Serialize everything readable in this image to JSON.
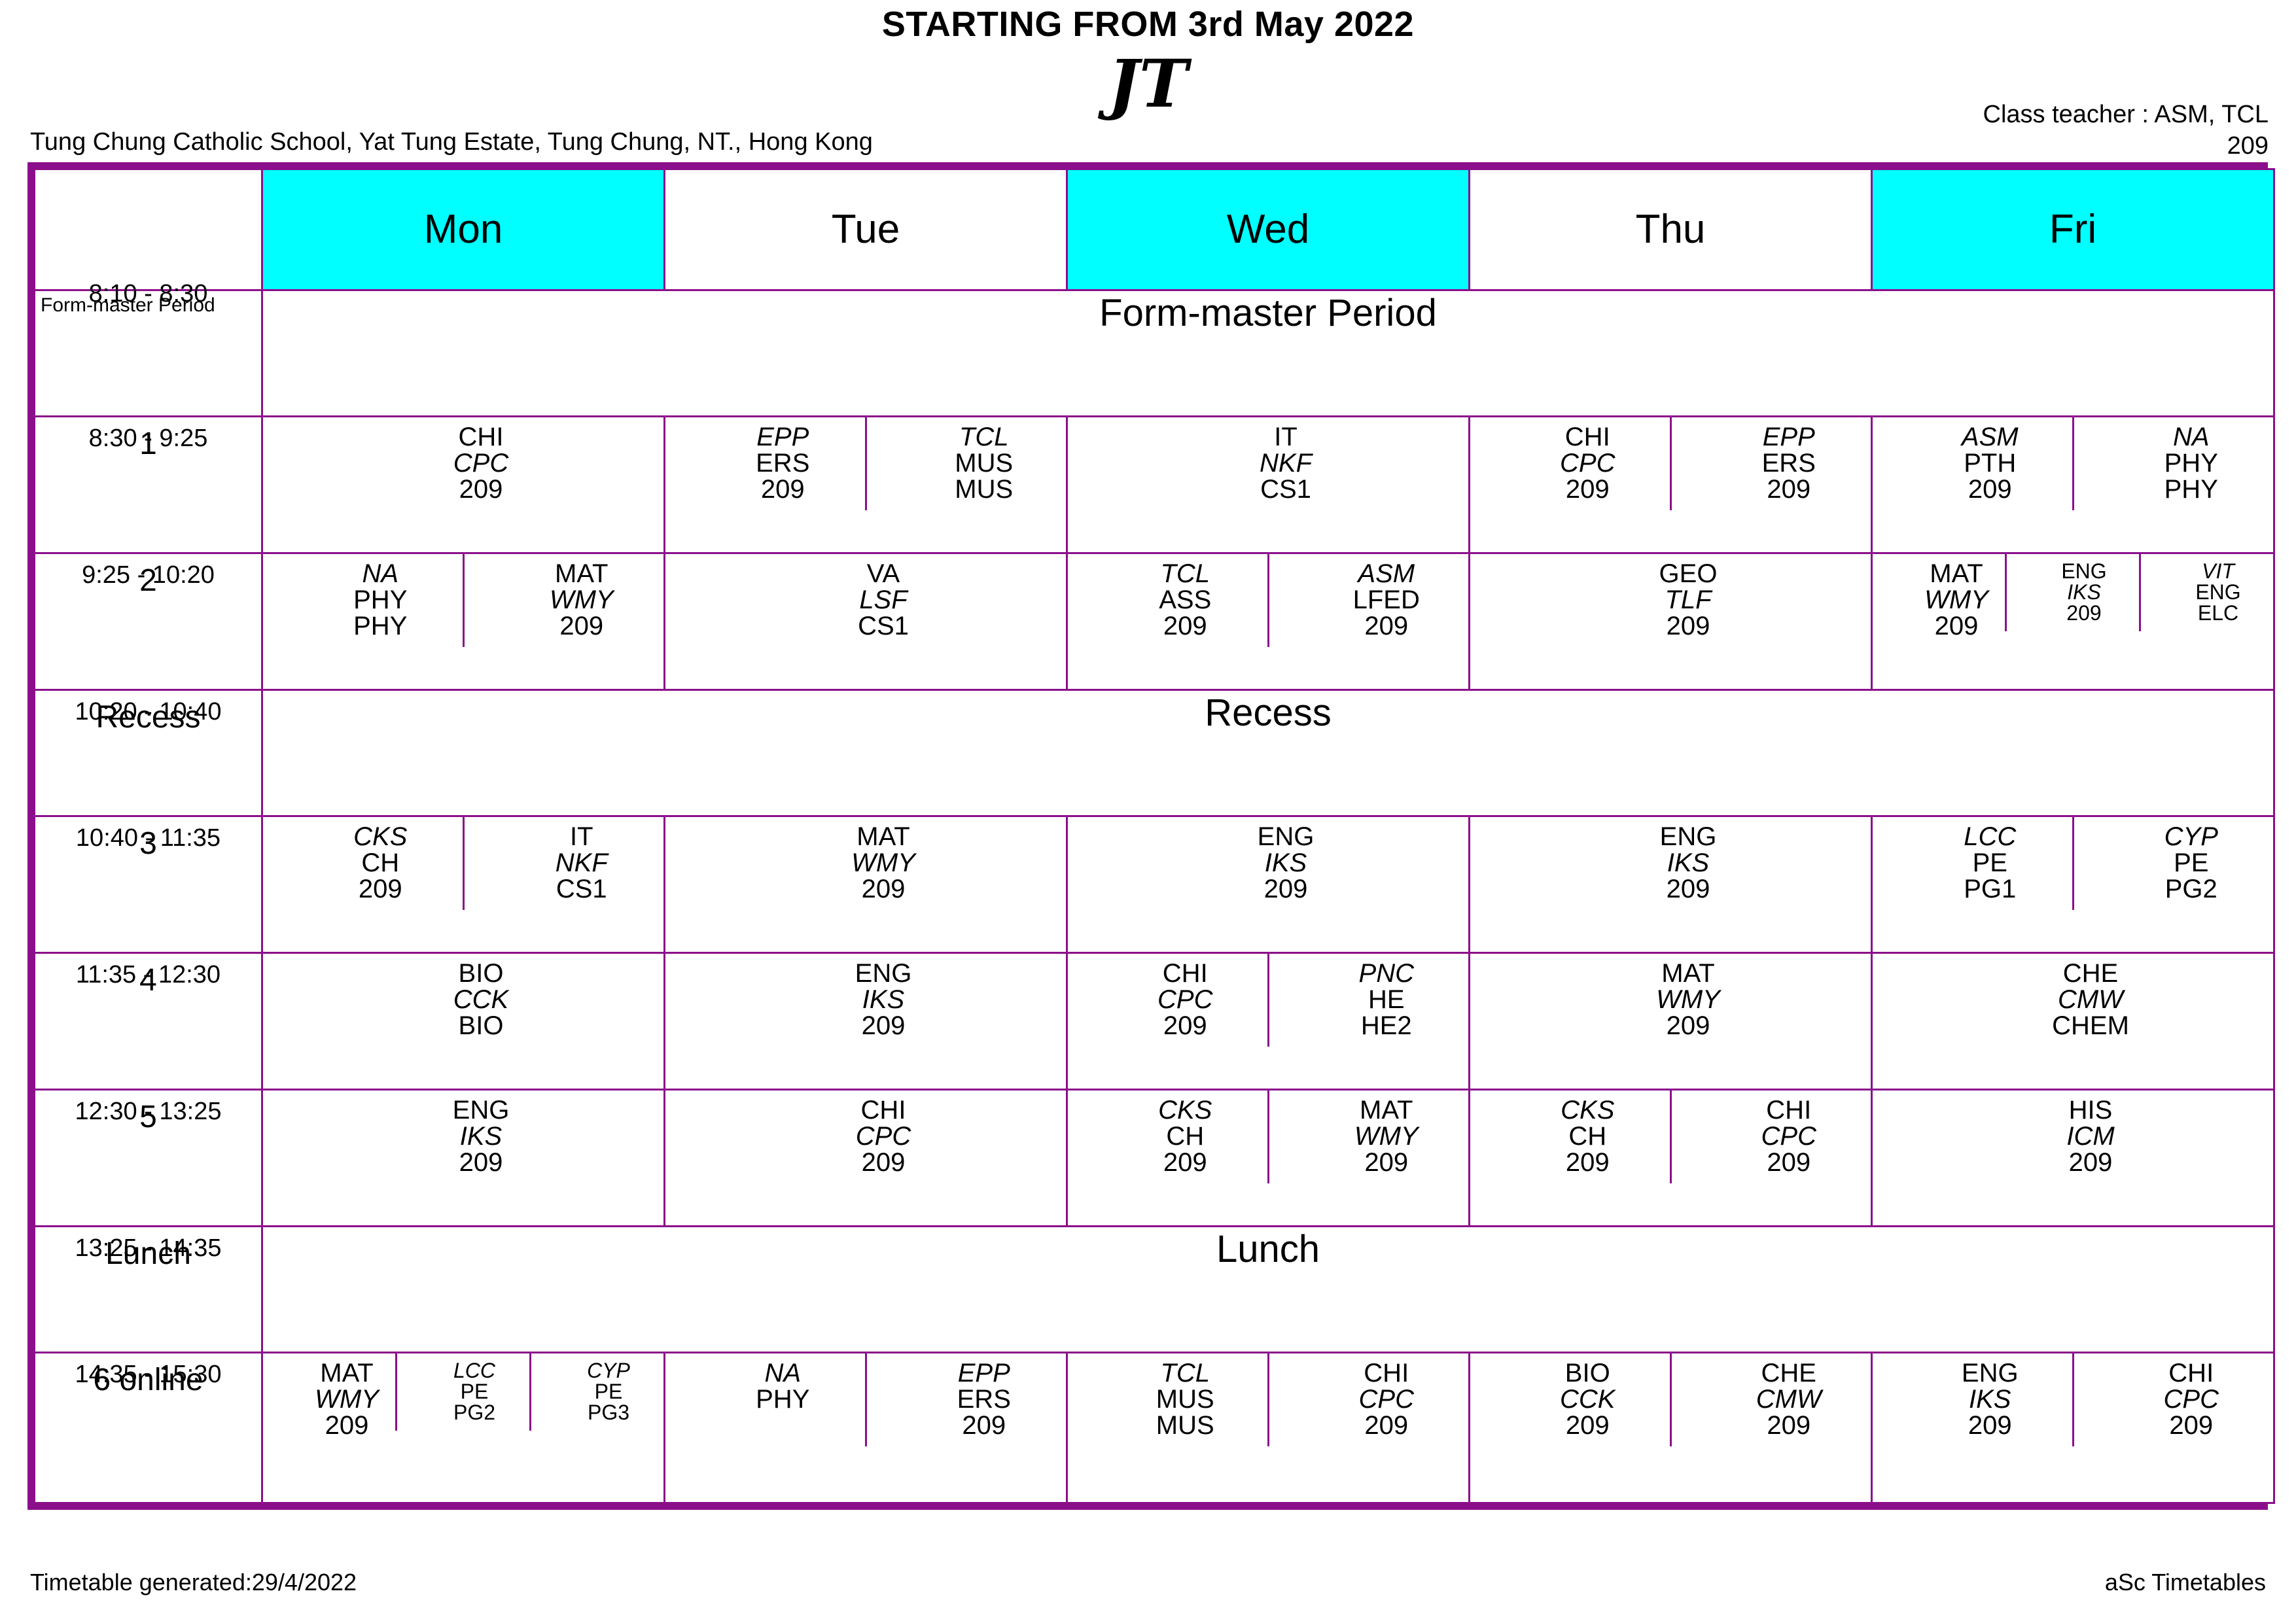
{
  "header": {
    "starting_from": "STARTING FROM 3rd May 2022",
    "logo_text": "JT",
    "school": "Tung Chung Catholic School, Yat Tung Estate, Tung Chung, NT., Hong Kong",
    "class_teacher": "Class teacher : ASM, TCL",
    "class_room": "209"
  },
  "colors": {
    "border": "#8b0f8b",
    "day_highlight": "#00ffff",
    "olive": "#6b8e0a",
    "light_green": "#8cf05a",
    "spring_green": "#00e89a",
    "mint": "#6fe8b4",
    "red": "#ff0000",
    "sky": "#7fb8f5",
    "azure": "#33c5f5",
    "blue": "#0a6ff0",
    "dodger": "#2b8cf0",
    "grey": "#9e9e9e",
    "purple": "#8b0f8b",
    "navy": "#0a3b9e",
    "dark_olive": "#7a7a08",
    "pale_green": "#d4f79a",
    "pink": "#f9cdf2",
    "green": "#0a9e4a",
    "yellow": "#ffff00"
  },
  "days": [
    {
      "label": "Mon",
      "highlight": true
    },
    {
      "label": "Tue",
      "highlight": false
    },
    {
      "label": "Wed",
      "highlight": true
    },
    {
      "label": "Thu",
      "highlight": false
    },
    {
      "label": "Fri",
      "highlight": true
    }
  ],
  "banner_rows": [
    {
      "label": "Form-master Period",
      "time": "8:10 - 8:30",
      "title": "Form-master Period",
      "label_small": true
    },
    {
      "label": "Recess",
      "time": "10:20 - 10:40",
      "title": "Recess",
      "label_small": false
    },
    {
      "label": "Lunch",
      "time": "13:25 - 14:35",
      "title": "Lunch",
      "label_small": false
    }
  ],
  "periods": [
    {
      "num": "1",
      "time": "8:30 - 9:25",
      "days": [
        {
          "cells": [
            {
              "color": "#6b8e0a",
              "teacher": "",
              "subject": "CHI",
              "teacher2": "CPC",
              "room": "209"
            }
          ]
        },
        {
          "cells": [
            {
              "color": "#8cf05a",
              "teacher": "EPP",
              "subject": "ERS",
              "room": "209"
            },
            {
              "color": "#00e89a",
              "teacher": "TCL",
              "subject": "MUS",
              "room": "MUS"
            }
          ]
        },
        {
          "cells": [
            {
              "color": "#6fe8b4",
              "teacher_below": true,
              "subject": "IT",
              "teacher": "NKF",
              "room": "CS1"
            }
          ]
        },
        {
          "cells": [
            {
              "color": "#6b8e0a",
              "teacher": "CPC",
              "subject": "CHI",
              "room": "209"
            },
            {
              "color": "#8cf05a",
              "teacher": "EPP",
              "subject": "ERS",
              "room": "209"
            }
          ]
        },
        {
          "cells": [
            {
              "color": "#ff0000",
              "teacher": "ASM",
              "subject": "PTH",
              "room": "209"
            },
            {
              "color": "#7fb8f5",
              "teacher": "NA",
              "subject": "PHY",
              "room": "PHY"
            }
          ]
        }
      ]
    },
    {
      "num": "2",
      "time": "9:25 - 10:20",
      "days": [
        {
          "cells": [
            {
              "color": "#7fb8f5",
              "teacher": "NA",
              "subject": "PHY",
              "room": "PHY"
            },
            {
              "color": "#33c5f5",
              "teacher": "WMY",
              "subject": "MAT",
              "room": "209"
            }
          ]
        },
        {
          "cells": [
            {
              "color": "#0a6ff0",
              "subject": "VA",
              "teacher": "LSF",
              "room": "CS1"
            }
          ]
        },
        {
          "cells": [
            {
              "color": "#00e89a",
              "teacher": "TCL",
              "subject": "ASS",
              "room": "209"
            },
            {
              "color": "#ff0000",
              "teacher": "ASM",
              "subject": "LFED",
              "room": "209"
            }
          ]
        },
        {
          "cells": [
            {
              "color": "#9e9e9e",
              "subject": "GEO",
              "teacher": "TLF",
              "room": "209"
            }
          ]
        },
        {
          "cells": [
            {
              "color": "#33c5f5",
              "teacher": "WMY",
              "subject": "MAT",
              "room": "209"
            },
            {
              "color": "#8b0f8b",
              "teacher": "IKS",
              "subject": "ENG",
              "room": "209",
              "narrow": true
            },
            {
              "color": "#0a3b9e",
              "teacher": "VIT",
              "subject": "ENG",
              "room": "ELC",
              "narrow": true
            }
          ]
        }
      ]
    },
    {
      "num": "3",
      "time": "10:40 - 11:35",
      "days": [
        {
          "cells": [
            {
              "color": "#2b8cf0",
              "teacher": "CKS",
              "subject": "CH",
              "room": "209"
            },
            {
              "color": "#6fe8b4",
              "teacher": "NKF",
              "subject": "IT",
              "room": "CS1"
            }
          ]
        },
        {
          "cells": [
            {
              "color": "#33c5f5",
              "subject": "MAT",
              "teacher": "WMY",
              "room": "209"
            }
          ]
        },
        {
          "cells": [
            {
              "color": "#8b0f8b",
              "subject": "ENG",
              "teacher": "IKS",
              "room": "209"
            }
          ]
        },
        {
          "cells": [
            {
              "color": "#8b0f8b",
              "subject": "ENG",
              "teacher": "IKS",
              "room": "209"
            }
          ]
        },
        {
          "cells": [
            {
              "color": "#7a7a08",
              "teacher": "LCC",
              "subject": "PE",
              "room": "PG1"
            },
            {
              "color": "#d4f79a",
              "teacher": "CYP",
              "subject": "PE",
              "room": "PG2"
            }
          ]
        }
      ]
    },
    {
      "num": "4",
      "time": "11:35 - 12:30",
      "days": [
        {
          "cells": [
            {
              "color": "#f9cdf2",
              "subject": "BIO",
              "teacher": "CCK",
              "room": "BIO"
            }
          ]
        },
        {
          "cells": [
            {
              "color": "#8b0f8b",
              "subject": "ENG",
              "teacher": "IKS",
              "room": "209"
            }
          ]
        },
        {
          "cells": [
            {
              "color": "#6b8e0a",
              "teacher": "CPC",
              "subject": "CHI",
              "room": "209"
            },
            {
              "color": "#33c5f5",
              "teacher": "PNC",
              "subject": "HE",
              "room": "HE2"
            }
          ]
        },
        {
          "cells": [
            {
              "color": "#33c5f5",
              "subject": "MAT",
              "teacher": "WMY",
              "room": "209"
            }
          ]
        },
        {
          "cells": [
            {
              "color": "#0a9e4a",
              "subject": "CHE",
              "teacher": "CMW",
              "room": "CHEM"
            }
          ]
        }
      ]
    },
    {
      "num": "5",
      "time": "12:30 - 13:25",
      "days": [
        {
          "cells": [
            {
              "color": "#8b0f8b",
              "subject": "ENG",
              "teacher": "IKS",
              "room": "209"
            }
          ]
        },
        {
          "cells": [
            {
              "color": "#6b8e0a",
              "subject": "CHI",
              "teacher": "CPC",
              "room": "209"
            }
          ]
        },
        {
          "cells": [
            {
              "color": "#2b8cf0",
              "teacher": "CKS",
              "subject": "CH",
              "room": "209"
            },
            {
              "color": "#33c5f5",
              "teacher": "WMY",
              "subject": "MAT",
              "room": "209"
            }
          ]
        },
        {
          "cells": [
            {
              "color": "#2b8cf0",
              "teacher": "CKS",
              "subject": "CH",
              "room": "209"
            },
            {
              "color": "#6b8e0a",
              "teacher": "CPC",
              "subject": "CHI",
              "room": "209"
            }
          ]
        },
        {
          "cells": [
            {
              "color": "#ffff00",
              "subject": "HIS",
              "teacher": "ICM",
              "room": "209"
            }
          ]
        }
      ]
    },
    {
      "num": "6 online",
      "time": "14:35 - 15:30",
      "days": [
        {
          "cells": [
            {
              "color": "#33c5f5",
              "teacher": "WMY",
              "subject": "MAT",
              "room": "209"
            },
            {
              "color": "#7a7a08",
              "teacher": "LCC",
              "subject": "PE",
              "room": "PG2",
              "narrow": true
            },
            {
              "color": "#d4f79a",
              "teacher": "CYP",
              "subject": "PE",
              "room": "PG3",
              "narrow": true
            }
          ]
        },
        {
          "cells": [
            {
              "color": "#7fb8f5",
              "teacher": "NA",
              "subject": "PHY",
              "room": ""
            },
            {
              "color": "#8cf05a",
              "teacher": "EPP",
              "subject": "ERS",
              "room": "209"
            }
          ]
        },
        {
          "cells": [
            {
              "color": "#00e89a",
              "teacher": "TCL",
              "subject": "MUS",
              "room": "MUS"
            },
            {
              "color": "#6b8e0a",
              "teacher": "CPC",
              "subject": "CHI",
              "room": "209"
            }
          ]
        },
        {
          "cells": [
            {
              "color": "#f9cdf2",
              "teacher": "CCK",
              "subject": "BIO",
              "room": "209"
            },
            {
              "color": "#0a9e4a",
              "teacher": "CMW",
              "subject": "CHE",
              "room": "209"
            }
          ]
        },
        {
          "cells": [
            {
              "color": "#8b0f8b",
              "teacher": "IKS",
              "subject": "ENG",
              "room": "209"
            },
            {
              "color": "#6b8e0a",
              "teacher": "CPC",
              "subject": "CHI",
              "room": "209"
            }
          ]
        }
      ]
    }
  ],
  "footer": {
    "generated": "Timetable generated:29/4/2022",
    "credit": "aSc Timetables"
  }
}
